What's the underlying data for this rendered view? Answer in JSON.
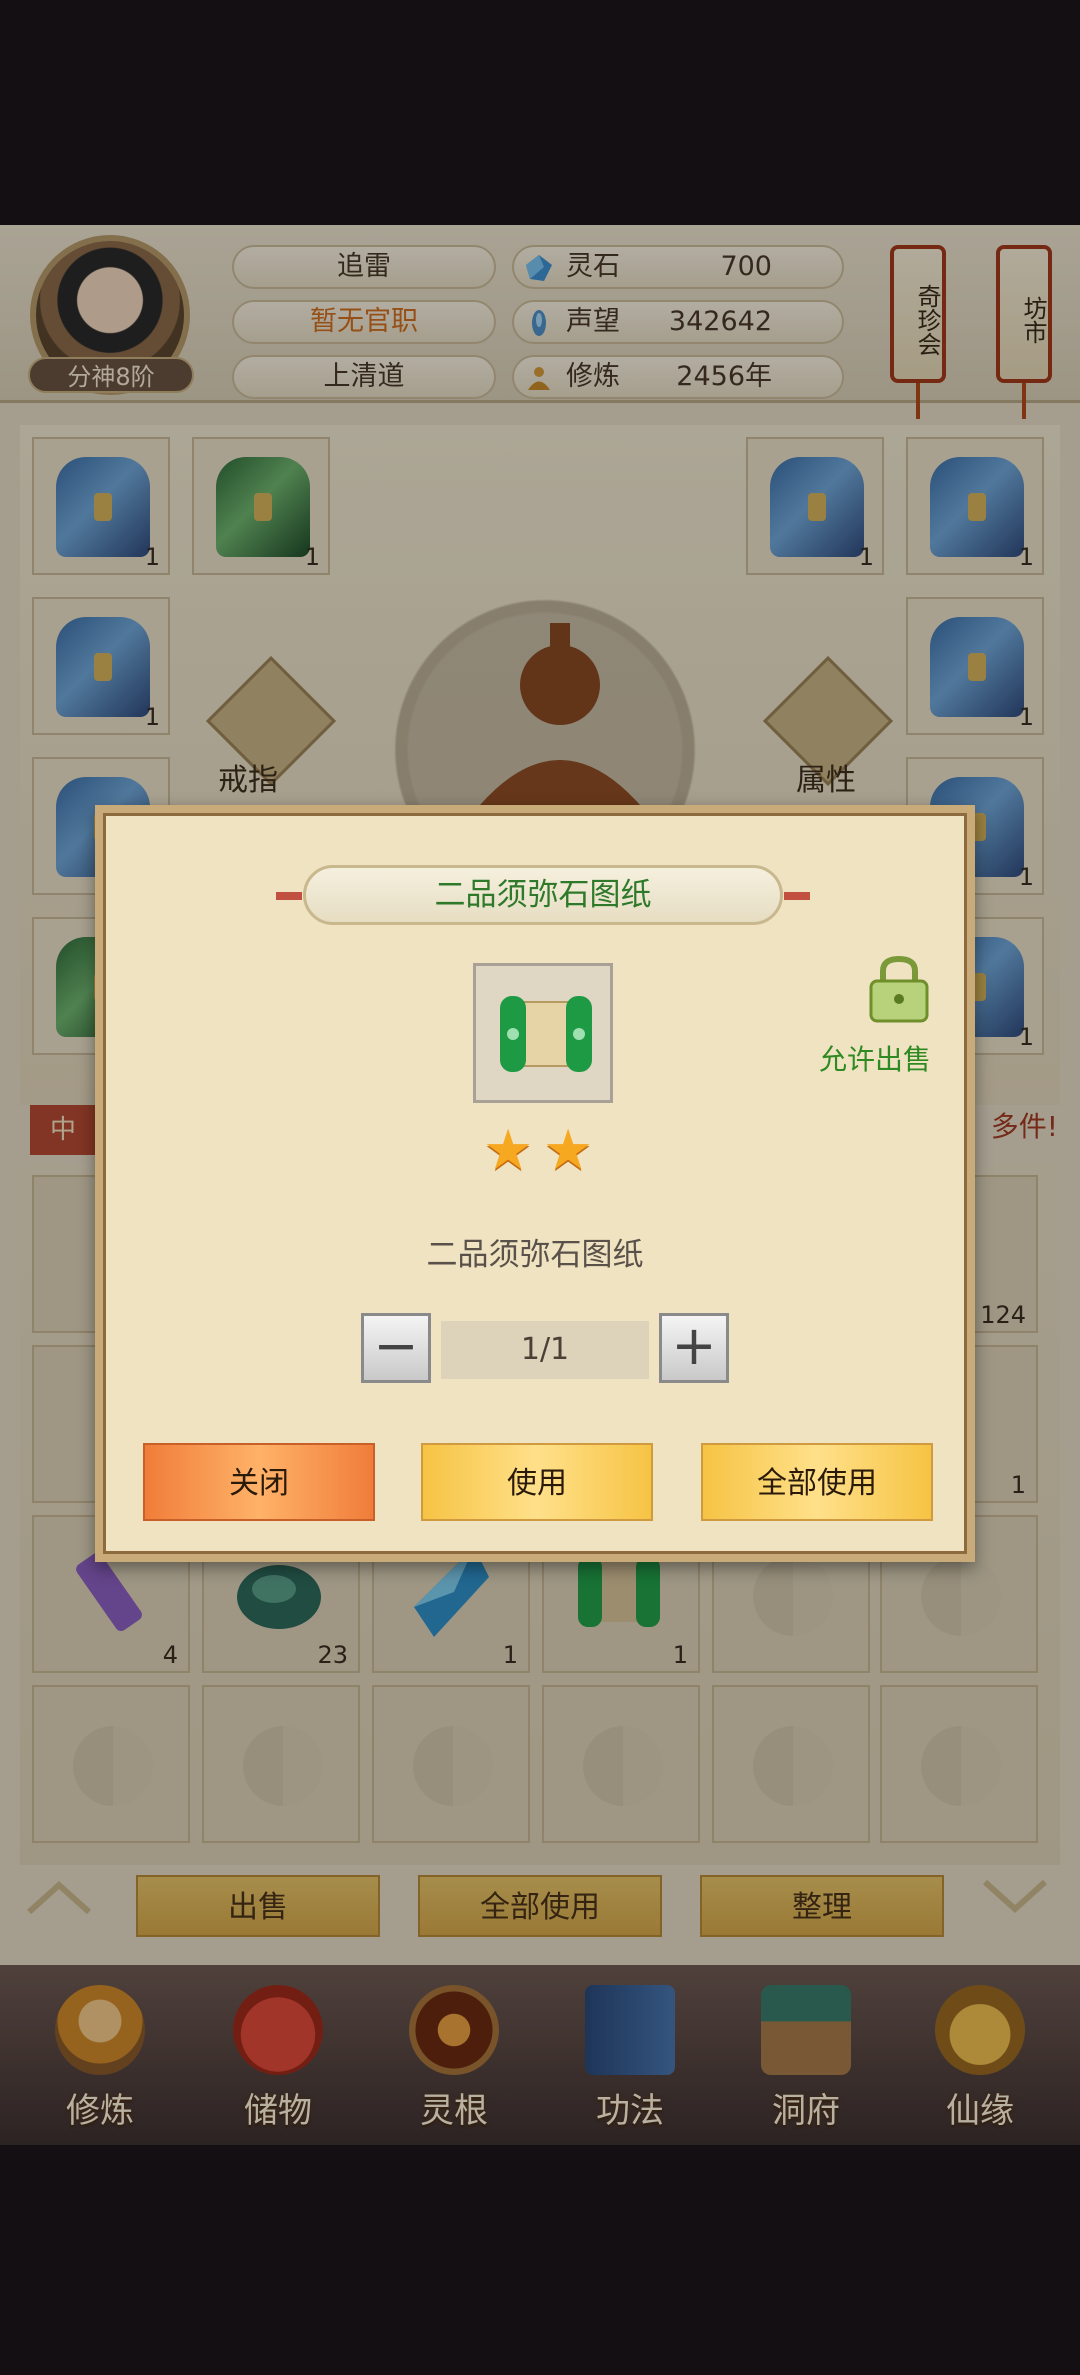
{
  "player": {
    "name": "追雷",
    "official_post": "暂无官职",
    "sect": "上清道",
    "rank": "分神8阶"
  },
  "resources": [
    {
      "label": "灵石",
      "value": "700",
      "icon": "spirit-stone-icon"
    },
    {
      "label": "声望",
      "value": "342642",
      "icon": "reputation-icon"
    },
    {
      "label": "修炼",
      "value": "2456年",
      "icon": "cultivation-icon"
    }
  ],
  "lanterns": {
    "treasure": "奇珍会",
    "market": "坊市"
  },
  "equipment": {
    "ring_label": "戒指",
    "attr_label": "属性",
    "slot_counts": [
      "1",
      "1",
      "1",
      "1",
      "1",
      "1",
      "1",
      "1",
      "1"
    ]
  },
  "ribbon": {
    "left_text": "中",
    "right_text": "多件!"
  },
  "bag": {
    "counts": [
      "124",
      "1",
      "4",
      "23",
      "1",
      "1"
    ]
  },
  "bottom_actions": {
    "sell": "出售",
    "use_all": "全部使用",
    "sort": "整理"
  },
  "nav": [
    {
      "label": "修炼",
      "icon": "cultivation-nav-icon"
    },
    {
      "label": "储物",
      "icon": "storage-bag-icon"
    },
    {
      "label": "灵根",
      "icon": "spirit-root-icon"
    },
    {
      "label": "功法",
      "icon": "technique-book-icon"
    },
    {
      "label": "洞府",
      "icon": "cave-mansion-icon"
    },
    {
      "label": "仙缘",
      "icon": "immortal-fate-icon"
    }
  ],
  "dialog": {
    "title": "二品须弥石图纸",
    "item_name": "二品须弥石图纸",
    "stars": 2,
    "sell_permission": "允许出售",
    "quantity": "1/1",
    "minus": "−",
    "plus": "+",
    "btn_close": "关闭",
    "btn_use": "使用",
    "btn_use_all": "全部使用"
  },
  "colors": {
    "title_green": "#2f7a2a",
    "official_orange": "#d07020",
    "close_button": "#f07d3a",
    "gold_button": "#f6c444"
  }
}
